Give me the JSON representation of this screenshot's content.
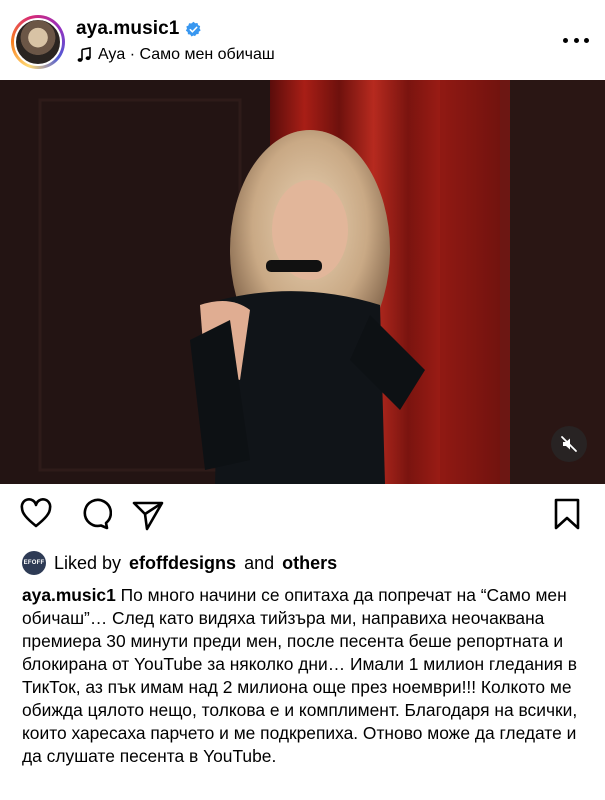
{
  "header": {
    "username": "aya.music1",
    "audio_label": "Aya · Само мен обичаш"
  },
  "icons": {
    "verified": "verified-badge-icon",
    "audio": "music-note-icon",
    "more": "more-options-icon",
    "mute": "speaker-muted-icon",
    "like": "heart-icon",
    "comment": "comment-bubble-icon",
    "share": "paper-plane-icon",
    "save": "bookmark-icon"
  },
  "colors": {
    "verified": "#3897f0",
    "curtain": "#8c1713"
  },
  "likes": {
    "avatar_text": "EFOFF",
    "prefix": "Liked by",
    "user": "efoffdesigns",
    "middle": "and",
    "others": "others"
  },
  "caption": {
    "username": "aya.music1",
    "text": "По много начини се опитаха да попречат на “Само мен обичаш”… След като видяха тийзъра ми, направиха неочаквана премиера 30 минути преди мен, после песента беше репортната и блокирана от YouTube за няколко дни… Имали 1 милион гледания в ТикТок, аз пък имам над 2 милиона още през ноември!!! Колкото ме обижда цялото нещо, толкова е и комплимент. Благодаря на всички, които харесаха парчето и ме подкрепиха. Отново може да гледате и да слушате песента в YouTube."
  }
}
